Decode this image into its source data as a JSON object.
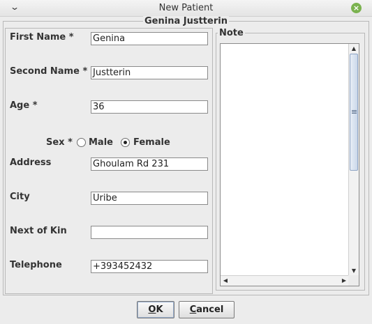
{
  "window": {
    "title": "New Patient",
    "menu_glyph": "⌄",
    "close_glyph": "×"
  },
  "form": {
    "group_title": "Genina Justterin",
    "fields": {
      "first_name": {
        "label": "First Name *",
        "value": "Genina"
      },
      "second_name": {
        "label": "Second Name *",
        "value": "Justterin"
      },
      "age": {
        "label": "Age *",
        "value": "36"
      },
      "address": {
        "label": "Address",
        "value": "Ghoulam Rd 231"
      },
      "city": {
        "label": "City",
        "value": "Uribe"
      },
      "next_of_kin": {
        "label": "Next of Kin",
        "value": ""
      },
      "telephone": {
        "label": "Telephone",
        "value": "+393452432"
      }
    },
    "sex": {
      "label": "Sex *",
      "options": [
        {
          "label": "Male",
          "selected": false
        },
        {
          "label": "Female",
          "selected": true
        }
      ]
    }
  },
  "note": {
    "title": "Note",
    "value": ""
  },
  "buttons": {
    "ok": {
      "mnemonic": "O",
      "rest": "K"
    },
    "cancel": {
      "mnemonic": "C",
      "rest": "ancel"
    }
  },
  "colors": {
    "background": "#ececec",
    "close_button": "#7ab24e",
    "scroll_thumb_border": "#8ea4c4"
  }
}
